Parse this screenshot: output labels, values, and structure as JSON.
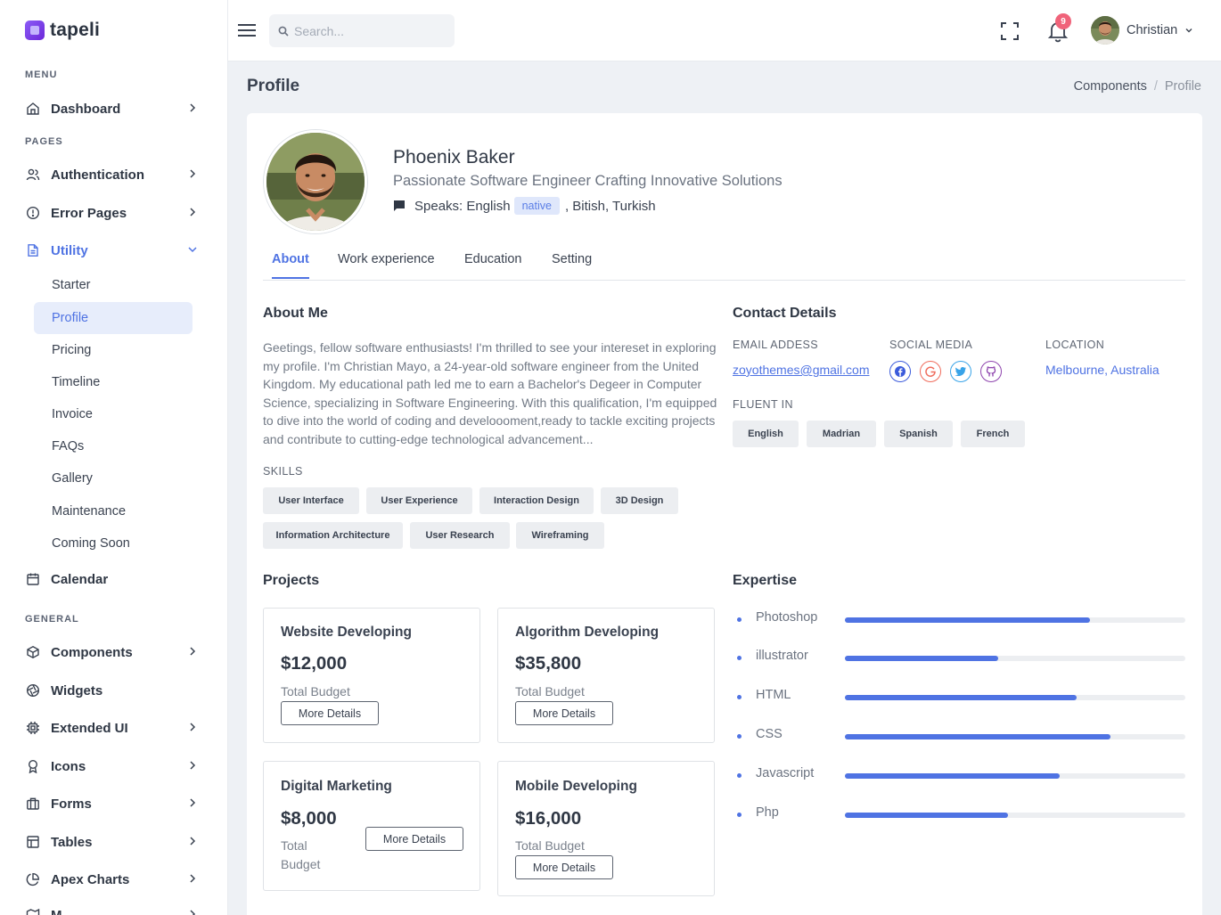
{
  "brand": {
    "name": "tapeli"
  },
  "sidebar": {
    "menu_heading": "MENU",
    "pages_heading": "PAGES",
    "general_heading": "GENERAL",
    "dashboard": "Dashboard",
    "authentication": "Authentication",
    "error_pages": "Error Pages",
    "utility": "Utility",
    "utility_items": [
      "Starter",
      "Profile",
      "Pricing",
      "Timeline",
      "Invoice",
      "FAQs",
      "Gallery",
      "Maintenance",
      "Coming Soon"
    ],
    "calendar": "Calendar",
    "components": "Components",
    "widgets": "Widgets",
    "extended_ui": "Extended UI",
    "icons": "Icons",
    "forms": "Forms",
    "tables": "Tables",
    "apex_charts": "Apex Charts",
    "maps": "M"
  },
  "topbar": {
    "search_placeholder": "Search...",
    "notification_count": "9",
    "user_name": "Christian"
  },
  "page": {
    "title": "Profile",
    "breadcrumb": [
      "Components",
      "/",
      "Profile"
    ]
  },
  "profile": {
    "name": "Phoenix Baker",
    "tagline": "Passionate Software Engineer Crafting Innovative Solutions",
    "speaks_label": "Speaks: English",
    "native_badge": "native",
    "other_languages": ", Bitish, Turkish"
  },
  "tabs": [
    "About",
    "Work experience",
    "Education",
    "Setting"
  ],
  "about": {
    "title": "About Me",
    "text": "Geetings, fellow software enthusiasts! I'm thrilled to see your intereset in exploring my profile. I'm Christian Mayo, a 24-year-old software engineer from the United Kingdom. My educational path led me to earn a Bachelor's Degeer in Computer Science, specializing in Software Engineering. With this qualification, I'm equipped to dive into the world of coding and develoooment,ready to tackle exciting projects and contribute to cutting-edge technological advancement...",
    "skills_label": "SKILLS",
    "skills": [
      "User Interface",
      "User Experience",
      "Interaction Design",
      "3D Design",
      "Information Architecture",
      "User Research",
      "Wireframing"
    ]
  },
  "contact": {
    "title": "Contact Details",
    "email_label": "EMAIL ADDESS",
    "email": "zoyothemes@gmail.com",
    "social_label": "SOCIAL MEDIA",
    "social_icons": [
      "facebook-icon",
      "google-icon",
      "twitter-icon",
      "github-icon"
    ],
    "location_label": "LOCATION",
    "location": "Melbourne, Australia",
    "fluent_label": "FLUENT IN",
    "languages": [
      "English",
      "Madrian",
      "Spanish",
      "French"
    ]
  },
  "projects": {
    "title": "Projects",
    "items": [
      {
        "title": "Website Developing",
        "amount": "$12,000",
        "label": "Total Budget",
        "button": "More Details"
      },
      {
        "title": "Algorithm Developing",
        "amount": "$35,800",
        "label": "Total Budget",
        "button": "More Details"
      },
      {
        "title": "Digital Marketing",
        "amount": "$8,000",
        "label_line1": "Total",
        "label_line2": "Budget",
        "button": "More Details"
      },
      {
        "title": "Mobile Developing",
        "amount": "$16,000",
        "label": "Total Budget",
        "button": "More Details"
      }
    ]
  },
  "expertise": {
    "title": "Expertise",
    "items": [
      {
        "name": "Photoshop",
        "percent": 72
      },
      {
        "name": "illustrator",
        "percent": 45
      },
      {
        "name": "HTML",
        "percent": 68
      },
      {
        "name": "CSS",
        "percent": 78
      },
      {
        "name": "Javascript",
        "percent": 63
      },
      {
        "name": "Php",
        "percent": 48
      }
    ]
  },
  "colors": {
    "accent": "#4f73e3",
    "badge": "#f0637a",
    "facebook": "#3b5bdb",
    "google": "#ef6b5b",
    "twitter": "#38a3e8",
    "github": "#8e44ad"
  }
}
